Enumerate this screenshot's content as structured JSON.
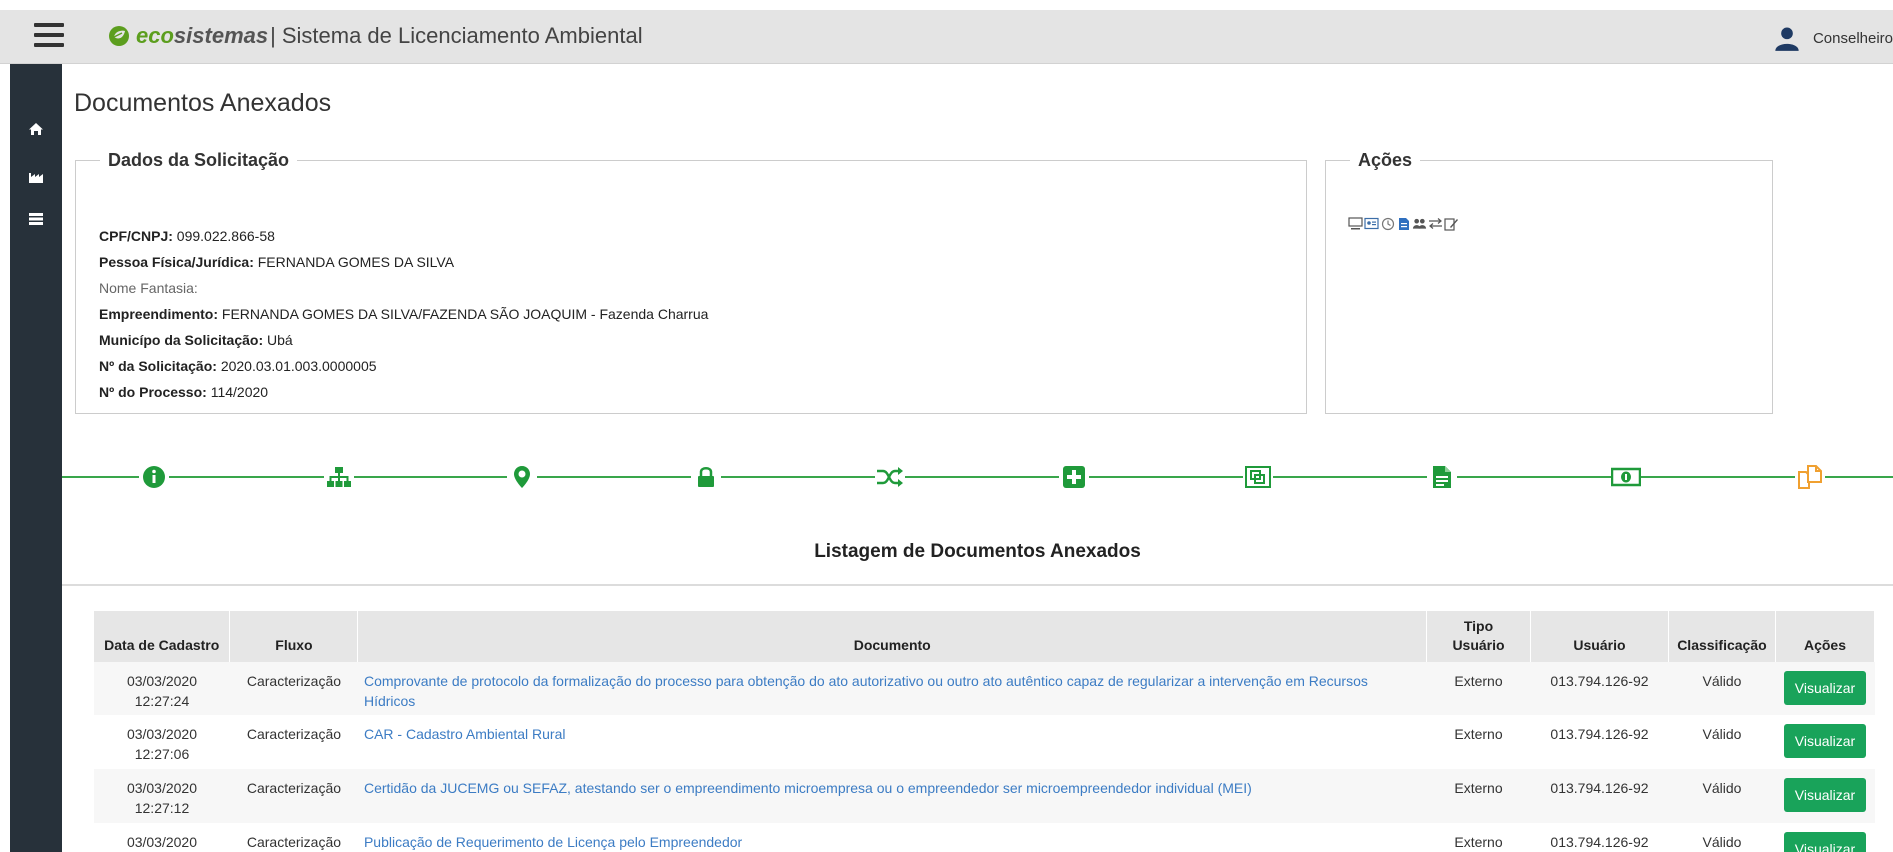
{
  "header": {
    "logo_eco": "eco",
    "logo_sistemas": "sistemas",
    "separator": "|",
    "title": "Sistema de Licenciamento Ambiental",
    "user_name": "Conselheiro"
  },
  "sidebar": {
    "items": [
      {
        "icon": "home-icon"
      },
      {
        "icon": "industry-icon"
      },
      {
        "icon": "list-icon"
      }
    ]
  },
  "page": {
    "title": "Documentos Anexados"
  },
  "solicitacao": {
    "legend": "Dados da Solicitação",
    "cpf_label": "CPF/CNPJ:",
    "cpf_value": "099.022.866-58",
    "pessoa_label": "Pessoa Física/Jurídica:",
    "pessoa_value": "FERNANDA GOMES DA SILVA",
    "fantasia_label": "Nome Fantasia:",
    "empreendimento_label": "Empreendimento:",
    "empreendimento_value": "FERNANDA GOMES DA SILVA/FAZENDA SÃO JOAQUIM - Fazenda Charrua",
    "municipio_label": "Municípo da Solicitação:",
    "municipio_value": "Ubá",
    "solicitacao_label": "Nº da Solicitação:",
    "solicitacao_value": "2020.03.01.003.0000005",
    "processo_label": "Nº do Processo:",
    "processo_value": "114/2020"
  },
  "acoes": {
    "legend": "Ações",
    "icons": [
      "monitor-icon",
      "id-card-icon",
      "clock-icon",
      "document-icon",
      "users-icon",
      "transfer-icon",
      "edit-icon"
    ]
  },
  "workflow": {
    "steps": [
      {
        "icon": "info-icon",
        "color": "#1f9a3a"
      },
      {
        "icon": "sitemap-icon",
        "color": "#1f9a3a"
      },
      {
        "icon": "map-marker-icon",
        "color": "#1f9a3a"
      },
      {
        "icon": "lock-icon",
        "color": "#1f9a3a"
      },
      {
        "icon": "random-icon",
        "color": "#1f9a3a"
      },
      {
        "icon": "plus-square-icon",
        "color": "#1f9a3a"
      },
      {
        "icon": "clone-icon",
        "color": "#1f9a3a"
      },
      {
        "icon": "file-text-icon",
        "color": "#1f9a3a"
      },
      {
        "icon": "money-icon",
        "color": "#1f9a3a"
      },
      {
        "icon": "copy-icon",
        "color": "#f0a030"
      }
    ]
  },
  "listing": {
    "title": "Listagem de Documentos Anexados",
    "headers": {
      "data": "Data de Cadastro",
      "fluxo": "Fluxo",
      "documento": "Documento",
      "tipo_line1": "Tipo",
      "tipo_line2": "Usuário",
      "usuario": "Usuário",
      "classificacao": "Classificação",
      "acoes": "Ações"
    },
    "rows": [
      {
        "date": "03/03/2020",
        "time": "12:27:24",
        "fluxo": "Caracterização",
        "documento": "Comprovante de protocolo da formalização do processo para obtenção do ato autorizativo ou outro ato autêntico capaz de regularizar a intervenção em Recursos Hídricos",
        "tipo": "Externo",
        "usuario": "013.794.126-92",
        "classificacao": "Válido",
        "acao": "Visualizar"
      },
      {
        "date": "03/03/2020",
        "time": "12:27:06",
        "fluxo": "Caracterização",
        "documento": "CAR - Cadastro Ambiental Rural",
        "tipo": "Externo",
        "usuario": "013.794.126-92",
        "classificacao": "Válido",
        "acao": "Visualizar"
      },
      {
        "date": "03/03/2020",
        "time": "12:27:12",
        "fluxo": "Caracterização",
        "documento": "Certidão da JUCEMG ou SEFAZ, atestando ser o empreendimento microempresa ou o empreendedor ser microempreendedor individual (MEI)",
        "tipo": "Externo",
        "usuario": "013.794.126-92",
        "classificacao": "Válido",
        "acao": "Visualizar"
      },
      {
        "date": "03/03/2020",
        "time": "",
        "fluxo": "Caracterização",
        "documento": "Publicação de Requerimento de Licença pelo Empreendedor",
        "tipo": "Externo",
        "usuario": "013.794.126-92",
        "classificacao": "Válido",
        "acao": "Visualizar"
      }
    ]
  },
  "colors": {
    "accent_green": "#39a64b",
    "button_green": "#19a35a",
    "link_blue": "#3c7cc4",
    "sidebar": "#27313a"
  }
}
